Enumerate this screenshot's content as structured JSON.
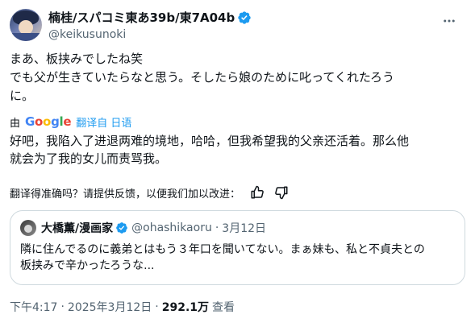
{
  "author": {
    "display_name": "楠桂/スパコミ東あ39b/東7A04b",
    "handle": "@keikusunoki",
    "avatar_icon": "user-avatar",
    "verified_icon": "verified-badge-icon"
  },
  "more_icon": "more-horizontal-icon",
  "tweet_text": "まあ、板挟みでしたね笑\nでも父が生きていたらなと思う。そしたら娘のために叱ってくれたろう\nに。",
  "translation_bar": {
    "by": "由",
    "logo": "Google",
    "link": "翻译自 日语"
  },
  "translation_text": "好吧，我陷入了进退两难的境地，哈哈，但我希望我的父亲还活着。那么他\n就会为了我的女儿而责骂我。",
  "feedback": {
    "prompt": "翻译得准确吗？请提供反馈，以便我们加以改进：",
    "thumbs_up_icon": "thumbs-up-icon",
    "thumbs_down_icon": "thumbs-down-icon"
  },
  "quote": {
    "display_name": "大橋薫/漫画家",
    "handle": "@ohashikaoru",
    "separator": "·",
    "date": "3月12日",
    "text": "隣に住んでるのに義弟とはもう３年口を聞いてない。まぁ妹も、私と不貞夫との\n板挟みで辛かったろうな..."
  },
  "meta": {
    "time": "下午4:17",
    "separator": "·",
    "date": "2025年3月12日",
    "views_count": "292.1万",
    "views_label": "查看"
  },
  "colors": {
    "text": "#0f1419",
    "secondary": "#536471",
    "accent": "#1d9bf0",
    "border": "#cfd9de"
  }
}
